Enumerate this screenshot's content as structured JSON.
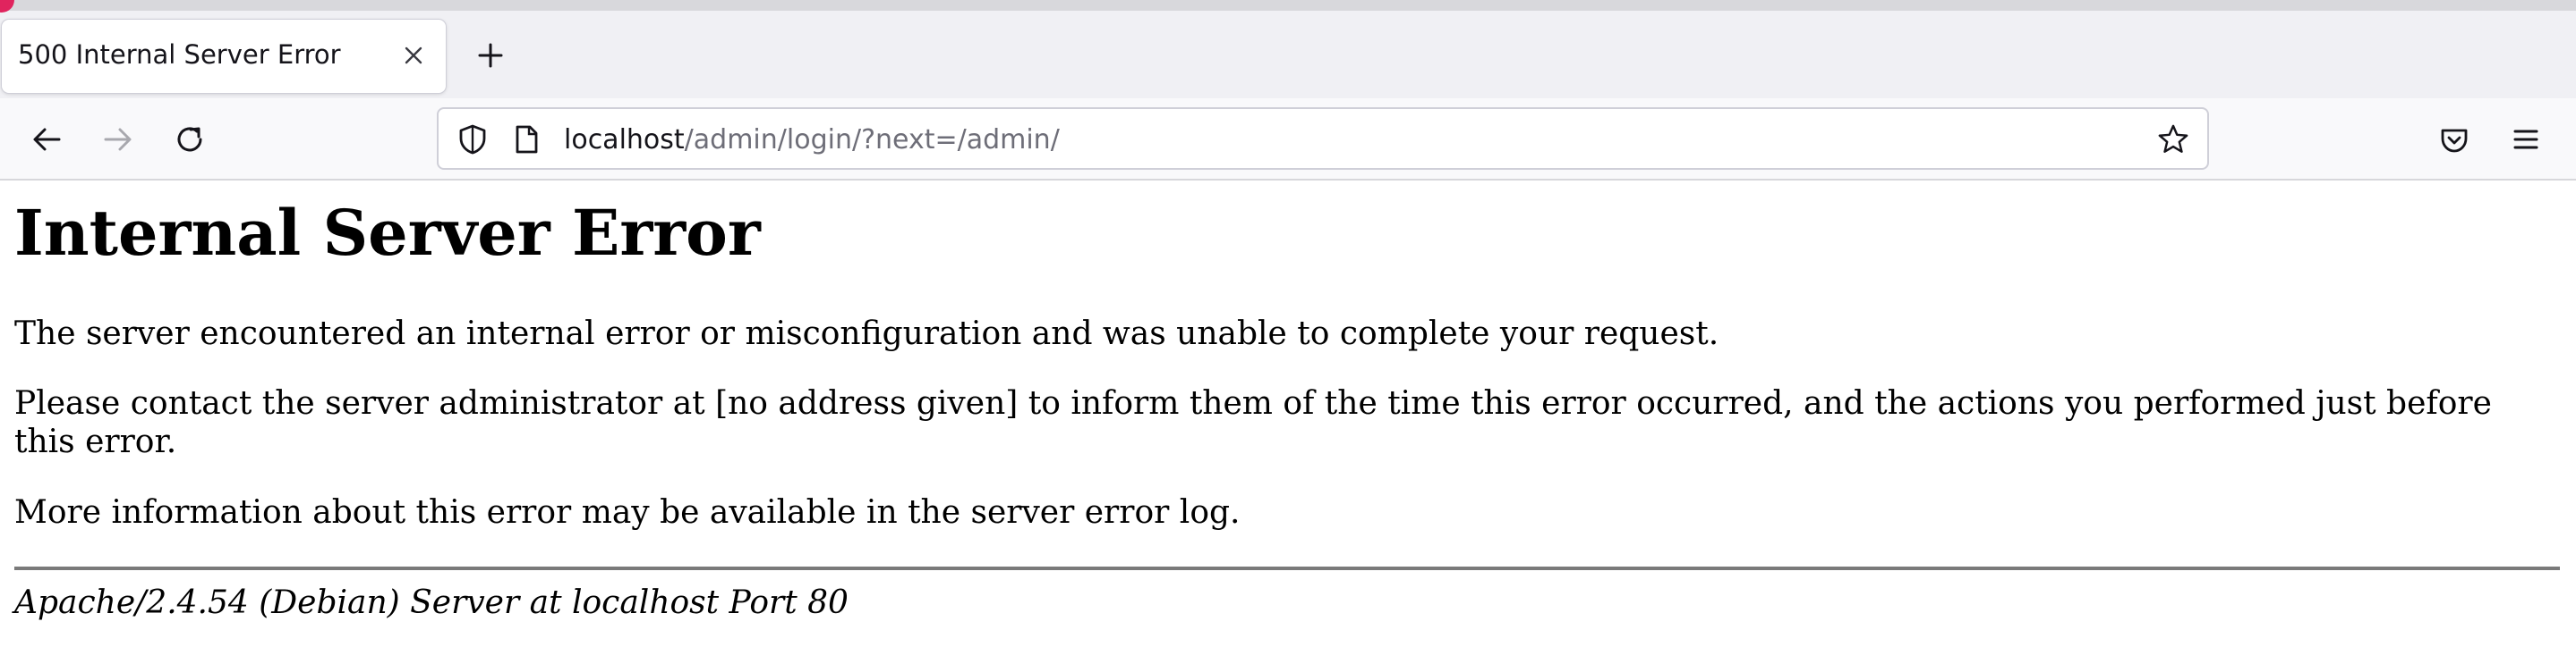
{
  "tab": {
    "title": "500 Internal Server Error"
  },
  "urlbar": {
    "host": "localhost",
    "path": "/admin/login/?next=/admin/"
  },
  "icons": {
    "back": "arrow-left-icon",
    "forward": "arrow-right-icon",
    "reload": "reload-icon",
    "shield": "shield-icon",
    "page": "page-icon",
    "bookmark": "star-icon",
    "pocket": "pocket-icon",
    "menu": "hamburger-menu-icon",
    "tab_close": "close-icon",
    "new_tab": "plus-icon"
  },
  "page": {
    "heading": "Internal Server Error",
    "paragraph1": "The server encountered an internal error or misconfiguration and was unable to complete your request.",
    "paragraph2": "Please contact the server administrator at [no address given] to inform them of the time this error occurred, and the actions you performed just before this error.",
    "paragraph3": "More information about this error may be available in the server error log.",
    "server_signature": "Apache/2.4.54 (Debian) Server at localhost Port 80"
  }
}
